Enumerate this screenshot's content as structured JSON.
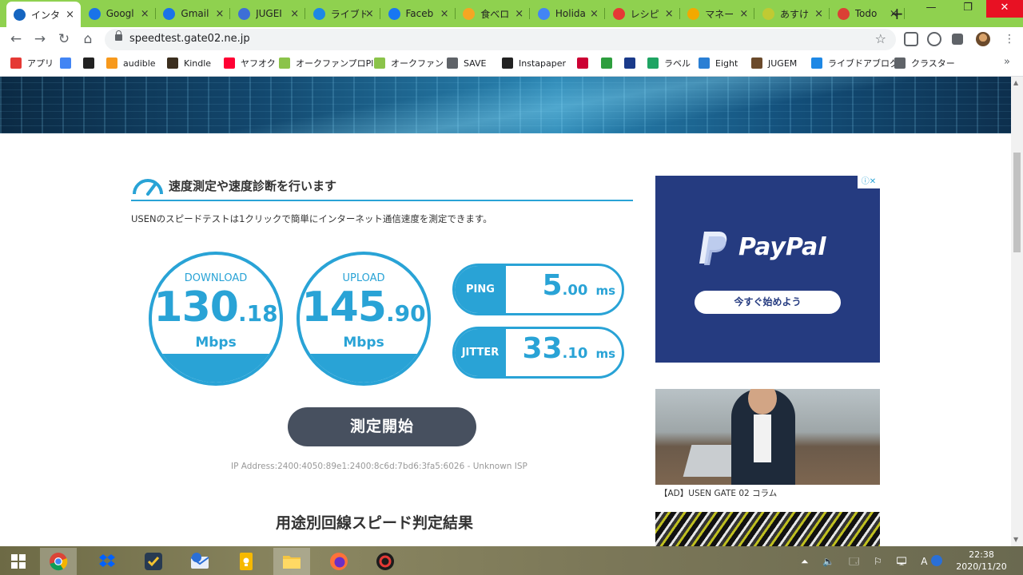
{
  "browser": {
    "tabs": [
      {
        "title": "インタ",
        "color": "#1565c0",
        "active": true
      },
      {
        "title": "Googl",
        "color": "#1a73e8"
      },
      {
        "title": "Gmail",
        "color": "#1a73e8"
      },
      {
        "title": "JUGEI",
        "color": "#3d6fd6"
      },
      {
        "title": "ライブド",
        "color": "#1e88e5"
      },
      {
        "title": "Faceb",
        "color": "#1877f2"
      },
      {
        "title": "食べロ",
        "color": "#f5a623"
      },
      {
        "title": "Holida",
        "color": "#4285f4"
      },
      {
        "title": "レシピ",
        "color": "#e53935"
      },
      {
        "title": "マネー",
        "color": "#f2a900"
      },
      {
        "title": "あすけ",
        "color": "#c0ca33"
      },
      {
        "title": "Todo",
        "color": "#db4035"
      }
    ],
    "tab_close": "×",
    "new_tab": "+",
    "window": {
      "minimize": "—",
      "restore": "❐",
      "close": "✕"
    },
    "nav": {
      "back": "←",
      "forward": "→",
      "reload": "↻",
      "home": "⌂"
    },
    "url": "speedtest.gate02.ne.jp",
    "star": "☆",
    "bookmarks": [
      {
        "label": "アプリ",
        "icon": "apps-grid-icon",
        "color": "#e53935"
      },
      {
        "label": "",
        "icon": "google-icon",
        "color": "#4285f4"
      },
      {
        "label": "",
        "icon": "amazon-icon",
        "color": "#222222"
      },
      {
        "label": "audible",
        "icon": "audible-icon",
        "color": "#f7991c"
      },
      {
        "label": "Kindle",
        "icon": "kindle-icon",
        "color": "#3b2e1e"
      },
      {
        "label": "ヤフオク",
        "icon": "yahoo-icon",
        "color": "#ff0033"
      },
      {
        "label": "オークファンプロPlus",
        "icon": "aucfan-icon",
        "color": "#8bc34a"
      },
      {
        "label": "オークファン",
        "icon": "aucfan-icon",
        "color": "#8bc34a"
      },
      {
        "label": "SAVE",
        "icon": "globe-icon",
        "color": "#5f6368"
      },
      {
        "label": "Instapaper",
        "icon": "instapaper-icon",
        "color": "#222222"
      },
      {
        "label": "",
        "icon": "d-icon",
        "color": "#cc0033"
      },
      {
        "label": "",
        "icon": "d-green-icon",
        "color": "#2e9e3e"
      },
      {
        "label": "",
        "icon": "com-icon",
        "color": "#1a3a8a"
      },
      {
        "label": "ラベル",
        "icon": "label-icon",
        "color": "#1fa463"
      },
      {
        "label": "Eight",
        "icon": "eight-icon",
        "color": "#2a7fd4"
      },
      {
        "label": "JUGEM",
        "icon": "jugem-icon",
        "color": "#6b4a2b"
      },
      {
        "label": "ライブドアブログ",
        "icon": "livedoor-icon",
        "color": "#1e88e5"
      },
      {
        "label": "クラスター",
        "icon": "globe-icon",
        "color": "#5f6368"
      }
    ],
    "bookmarks_more": "»"
  },
  "page": {
    "section_title": "速度測定や速度診断を行います",
    "description": "USENのスピードテストは1クリックで簡単にインターネット通信速度を測定できます。",
    "download": {
      "label": "DOWNLOAD",
      "int": "130",
      "dec": ".18",
      "unit": "Mbps"
    },
    "upload": {
      "label": "UPLOAD",
      "int": "145",
      "dec": ".90",
      "unit": "Mbps"
    },
    "ping": {
      "label": "PING",
      "int": "5",
      "dec": ".00",
      "unit": "ms"
    },
    "jitter": {
      "label": "JITTER",
      "int": "33",
      "dec": ".10",
      "unit": "ms"
    },
    "start_button": "測定開始",
    "ip_line": "IP Address:2400:4050:89e1:2400:8c6d:7bd6:3fa5:6026 - Unknown ISP",
    "result_title": "用途別回線スピード判定結果",
    "accent": "#29a3d6"
  },
  "sidebar": {
    "ad_badge": "ⓘ✕",
    "ad_brand": "PayPal",
    "ad_button": "今すぐ始めよう",
    "article_caption": "【AD】USEN GATE 02 コラム"
  },
  "taskbar": {
    "tray": "⏶ 🔈 🗔 ⚐ 🖵 A",
    "time": "22:38",
    "date": "2020/11/20"
  }
}
